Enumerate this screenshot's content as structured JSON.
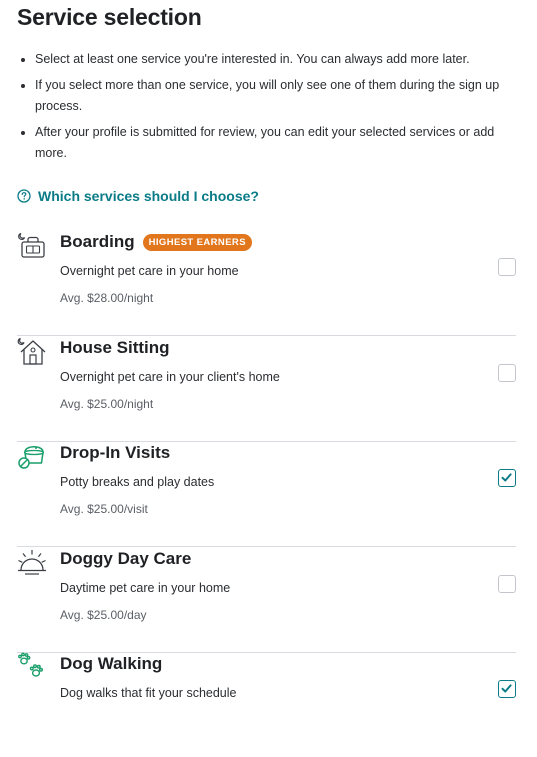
{
  "page": {
    "title": "Service selection",
    "bullets": [
      "Select at least one service you're interested in. You can always add more later.",
      "If you select more than one service, you will only see one of them during the sign up process.",
      "After your profile is submitted for review, you can edit your selected services or add more."
    ],
    "help_link": "Which services should I choose?"
  },
  "services": [
    {
      "title": "Boarding",
      "badge": "HIGHEST EARNERS",
      "description": "Overnight pet care in your home",
      "price": "Avg. $28.00/night",
      "checked": false,
      "icon": "boarding-icon"
    },
    {
      "title": "House Sitting",
      "description": "Overnight pet care in your client's home",
      "price": "Avg. $25.00/night",
      "checked": false,
      "icon": "house-sitting-icon"
    },
    {
      "title": "Drop-In Visits",
      "description": "Potty breaks and play dates",
      "price": "Avg. $25.00/visit",
      "checked": true,
      "icon": "drop-in-visits-icon"
    },
    {
      "title": "Doggy Day Care",
      "description": "Daytime pet care in your home",
      "price": "Avg. $25.00/day",
      "checked": false,
      "icon": "doggy-day-care-icon"
    },
    {
      "title": "Dog Walking",
      "description": "Dog walks that fit your schedule",
      "checked": true,
      "icon": "dog-walking-icon"
    }
  ],
  "colors": {
    "accent": "#0a7b87",
    "badge": "#e2761d",
    "icon_green": "#1a9e6a",
    "text": "#1f2124"
  }
}
